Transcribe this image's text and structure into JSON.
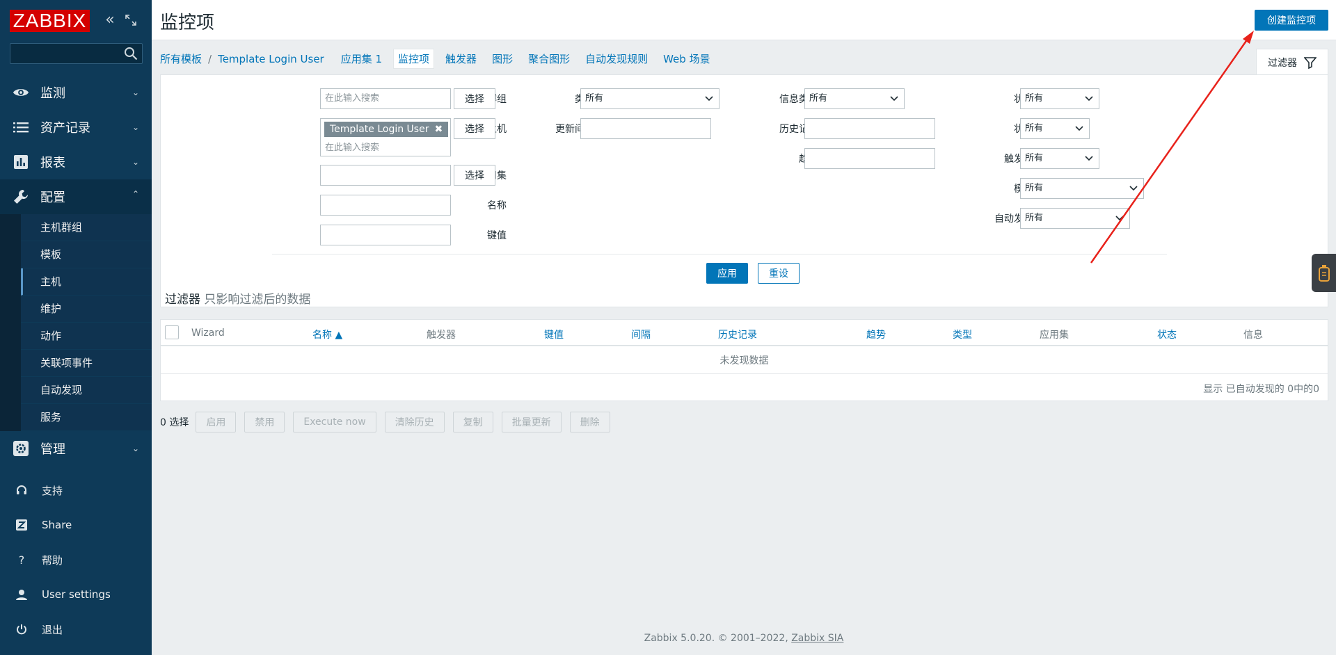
{
  "brand": "ZABBIX",
  "sidebar": {
    "search_placeholder": "",
    "menu": {
      "monitoring": "监测",
      "inventory": "资产记录",
      "reports": "报表",
      "configuration": "配置",
      "administration": "管理"
    },
    "submenu": [
      "主机群组",
      "模板",
      "主机",
      "维护",
      "动作",
      "关联项事件",
      "自动发现",
      "服务"
    ],
    "bottom": {
      "support": "支持",
      "share": "Share",
      "help": "帮助",
      "user_settings": "User settings",
      "logout": "退出"
    }
  },
  "header": {
    "title": "监控项",
    "create_button": "创建监控项"
  },
  "breadcrumbs": {
    "all_templates": "所有模板",
    "separator": "/",
    "template": "Template Login User",
    "applications": "应用集 1",
    "items": "监控项",
    "triggers": "触发器",
    "graphs": "图形",
    "screens": "聚合图形",
    "discovery": "自动发现规则",
    "web": "Web 场景"
  },
  "filter": {
    "tab_label": "过滤器",
    "host_group_label": "主机群组",
    "host_group_placeholder": "在此输入搜索",
    "select_label": "选择",
    "host_label": "主机",
    "host_tag": "Template Login User",
    "host_placeholder": "在此输入搜索",
    "application_label": "应用集",
    "name_label": "名称",
    "key_label": "键值",
    "type_label": "类型",
    "type_value": "所有",
    "interval_label": "更新间隔",
    "info_type_label": "信息类型",
    "info_type_value": "所有",
    "history_label": "历史记录",
    "trends_label": "趋势",
    "status_label": "状态",
    "status_value": "所有",
    "state_label": "状态",
    "state_value": "所有",
    "triggers_label": "触发器",
    "triggers_value": "所有",
    "template_label": "模板",
    "template_value": "所有",
    "discovery_label": "自动发现",
    "discovery_value": "所有",
    "apply": "应用",
    "reset": "重设",
    "note_main": "过滤器",
    "note_sub": "只影响过滤后的数据"
  },
  "table": {
    "columns": [
      "Wizard",
      "名称 ▲",
      "触发器",
      "键值",
      "间隔",
      "历史记录",
      "趋势",
      "类型",
      "应用集",
      "状态",
      "信息"
    ],
    "no_data": "未发现数据",
    "count_text": "显示 已自动发现的 0中的0"
  },
  "actions": {
    "selected": "0 选择",
    "buttons": [
      "启用",
      "禁用",
      "Execute now",
      "清除历史",
      "复制",
      "批量更新",
      "删除"
    ]
  },
  "footer": {
    "text": "Zabbix 5.0.20. © 2001–2022, ",
    "link": "Zabbix SIA"
  },
  "colors": {
    "sidebar": "#0e3a58",
    "brand": "#d40000",
    "accent": "#0275b8",
    "annotation_arrow": "#e8221b"
  }
}
